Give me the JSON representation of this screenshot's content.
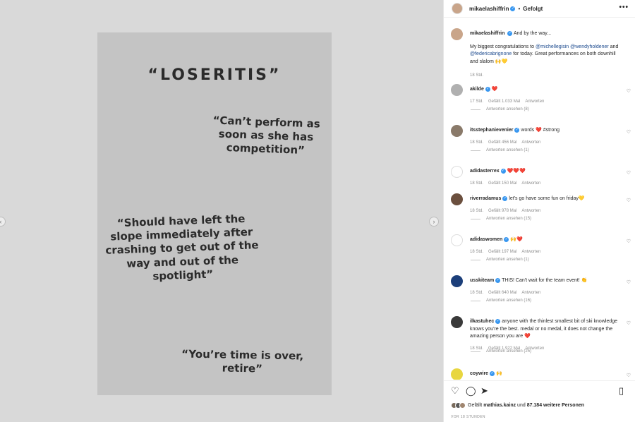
{
  "post": {
    "slide_text": {
      "title": "“LOSERITIS”",
      "quote1": "“Can’t perform as soon as she has competition”",
      "quote2": "“Should have left  the slope immediately after crashing to get out of the way and out of the spotlight”",
      "quote3": "“You’re time is over, retire”"
    },
    "prev_icon": "chevron-left-icon",
    "next_icon": "chevron-right-icon"
  },
  "header": {
    "username": "mikaelashiffrin",
    "separator": "•",
    "follow_status": "Gefolgt",
    "more": "•••"
  },
  "caption": {
    "username": "mikaelashiffrin",
    "lead": "And by the way...",
    "text_before": "My biggest congratulations to ",
    "mention1": "@michellegisin",
    "mention2": "@wendyholdener",
    "and": "and",
    "mention3": "@federicabrignone",
    "text_after": " for today. Great performances on both downhill and slalom 🙌💛",
    "time": "18 Std."
  },
  "comments": [
    {
      "username": "akilde",
      "text": "❤️",
      "time": "17 Std.",
      "likes": "Gefällt 1.033 Mal",
      "reply": "Antworten",
      "replies": "Antworten ansehen (8)",
      "avatar_color": "#b0b0b0"
    },
    {
      "username": "itsstephanievenier",
      "text": "words ❤️ #strong",
      "time": "18 Std.",
      "likes": "Gefällt 456 Mal",
      "reply": "Antworten",
      "replies": "Antworten ansehen (1)",
      "avatar_color": "#8a7a6a"
    },
    {
      "username": "adidasterrex",
      "text": "❤️❤️❤️",
      "time": "18 Std.",
      "likes": "Gefällt 150 Mal",
      "reply": "Antworten",
      "replies": "",
      "avatar_color": "#ffffff"
    },
    {
      "username": "riverradamus",
      "text": "let's go have some fun on friday💛",
      "time": "18 Std.",
      "likes": "Gefällt 978 Mal",
      "reply": "Antworten",
      "replies": "Antworten ansehen (15)",
      "avatar_color": "#6b4f3e"
    },
    {
      "username": "adidaswomen",
      "text": "🙌❤️",
      "time": "18 Std.",
      "likes": "Gefällt 197 Mal",
      "reply": "Antworten",
      "replies": "Antworten ansehen (1)",
      "avatar_color": "#ffffff"
    },
    {
      "username": "usskiteam",
      "text": "THIS! Can't wait for the team event! 👏",
      "time": "18 Std.",
      "likes": "Gefällt 640 Mal",
      "reply": "Antworten",
      "replies": "Antworten ansehen (16)",
      "avatar_color": "#1c3f7a"
    },
    {
      "username": "ilkastuhec",
      "text": "anyone with the thinlest smallest bit of ski knowledge knows you're the best. medal or no medal, it does not change the amazing person you are ❤️",
      "time": "18 Std.",
      "likes": "Gefällt 1.922 Mal",
      "reply": "Antworten",
      "replies": "Antworten ansehen (25)",
      "avatar_color": "#3a3a3a"
    },
    {
      "username": "coywire",
      "text": "🙌",
      "time": "",
      "likes": "",
      "reply": "",
      "replies": "",
      "avatar_color": "#e8d640"
    }
  ],
  "footer": {
    "like_icon": "heart-outline-icon",
    "comment_icon": "comment-icon",
    "share_icon": "share-icon",
    "save_icon": "bookmark-icon",
    "liked_by_prefix": "Gefällt ",
    "liked_by_user": "mathias.kainz",
    "liked_by_middle": " und ",
    "liked_by_count": "87.184 weitere Personen",
    "timestamp": "VOR 18 STUNDEN"
  },
  "colors": {
    "verified": "#3897f0",
    "mention": "#1c4a8e",
    "heart": "#d0021b",
    "media_bg": "#d9d9d9"
  }
}
